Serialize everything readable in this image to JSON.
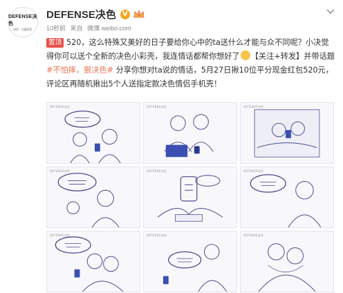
{
  "account": {
    "logo_text": "DEFENSE决色",
    "logo_sub": "决色 · 为爱而生",
    "name": "DEFENSE决色",
    "verified_glyph": "V",
    "badge_icon": "vip-crown-icon"
  },
  "meta": {
    "time": "10秒前",
    "source_prefix": "来自",
    "source": "微博 weibo.com"
  },
  "post": {
    "pin_label": "置顶",
    "part1": "520，这么特殊又美好的日子要给你心中的ta送什么才能与众不同呢？小决觉得你可以送个全新的决色小彩壳，我连情话都帮你想好了",
    "part2": "【关注+转发】并带话题",
    "topic": "#不怕摔，狠决色#",
    "part3": " 分享你想对ta说的情话，5月27日揪10位平分现金红包520元，评论区再随机揪出5个人送指定款决色情侣手机壳！"
  },
  "gallery": {
    "watermark": "DEFENSE决色",
    "images": [
      {
        "name": "comic-panel-1"
      },
      {
        "name": "comic-panel-2"
      },
      {
        "name": "comic-panel-3"
      },
      {
        "name": "comic-panel-4"
      },
      {
        "name": "comic-panel-5"
      },
      {
        "name": "comic-panel-6"
      },
      {
        "name": "comic-panel-7"
      },
      {
        "name": "comic-panel-8"
      },
      {
        "name": "comic-panel-9"
      }
    ]
  },
  "colors": {
    "accent": "#eb7350",
    "pin": "#e8524a",
    "verified": "#f6a623",
    "line": "#4b4a8c"
  }
}
